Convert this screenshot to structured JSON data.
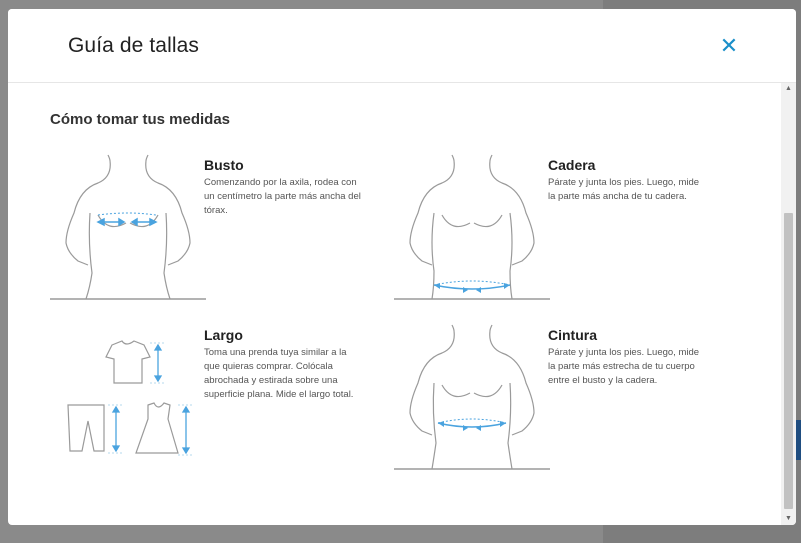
{
  "modal": {
    "title": "Guía de tallas",
    "close_icon": "close-icon"
  },
  "section": {
    "title": "Cómo tomar tus medidas"
  },
  "measures": [
    {
      "title": "Busto",
      "description": "Comenzando por la axila, rodea con un centímetro la parte más ancha del tórax.",
      "icon": "bust-measure-icon"
    },
    {
      "title": "Cadera",
      "description": "Párate y junta los pies. Luego, mide la parte más ancha de tu cadera.",
      "icon": "hip-measure-icon"
    },
    {
      "title": "Largo",
      "description": "Toma una prenda tuya similar a la que quieras comprar. Colócala abrochada y estirada sobre una superficie plana. Mide el largo total.",
      "icon": "garment-length-icon"
    },
    {
      "title": "Cintura",
      "description": "Párate y junta los pies. Luego, mide la parte más estrecha de tu cuerpo entre el busto y la cadera.",
      "icon": "waist-measure-icon"
    }
  ],
  "colors": {
    "accent": "#1a8fc9",
    "measure_line": "#4aa3df",
    "outline": "#9a9a9a"
  }
}
